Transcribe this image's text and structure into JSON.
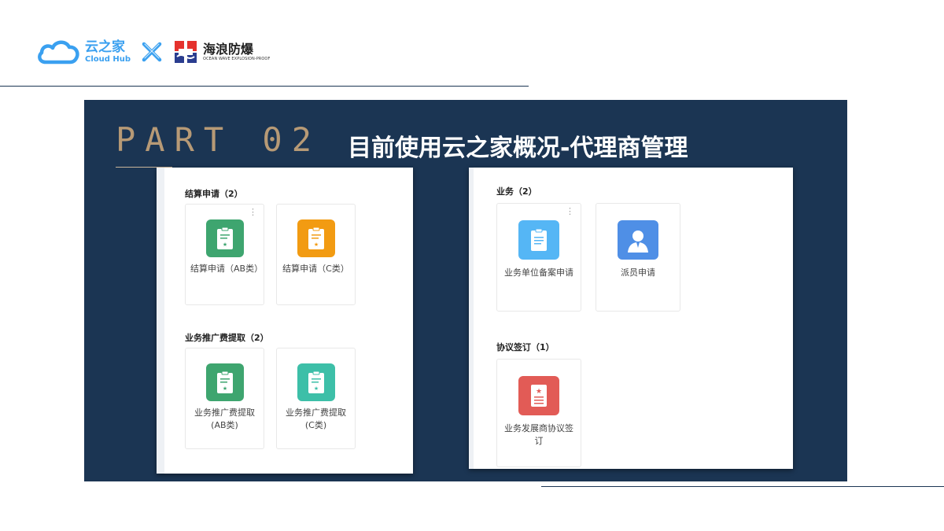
{
  "header": {
    "cloudhub_cn": "云之家",
    "cloudhub_en": "Cloud Hub",
    "partner_cn": "海浪防爆",
    "partner_en": "OCEAN WAVE EXPLOSION-PROOF"
  },
  "panel": {
    "part_label": "PART 02",
    "title": "目前使用云之家概况-代理商管理"
  },
  "left_card": {
    "groups": [
      {
        "title": "结算申请（2）",
        "apps": [
          {
            "label": "结算申请（AB类）",
            "icon": "document-star-icon",
            "color": "#3ea56f"
          },
          {
            "label": "结算申请（C类）",
            "icon": "document-star-icon",
            "color": "#f29b12"
          }
        ]
      },
      {
        "title": "业务推广费提取（2）",
        "apps": [
          {
            "label": "业务推广费提取(AB类)",
            "icon": "document-star-icon",
            "color": "#3ea56f"
          },
          {
            "label": "业务推广费提取(C类)",
            "icon": "document-star-icon",
            "color": "#3dbfa8"
          }
        ]
      }
    ]
  },
  "right_card": {
    "groups": [
      {
        "title": "业务（2）",
        "apps": [
          {
            "label": "业务单位备案申请",
            "icon": "document-icon",
            "color": "#55b6f5"
          },
          {
            "label": "派员申请",
            "icon": "person-icon",
            "color": "#4f8fe6"
          }
        ]
      },
      {
        "title": "协议签订（1）",
        "apps": [
          {
            "label": "业务发展商协议签订",
            "icon": "star-document-icon",
            "color": "#e25b56"
          }
        ]
      }
    ]
  }
}
